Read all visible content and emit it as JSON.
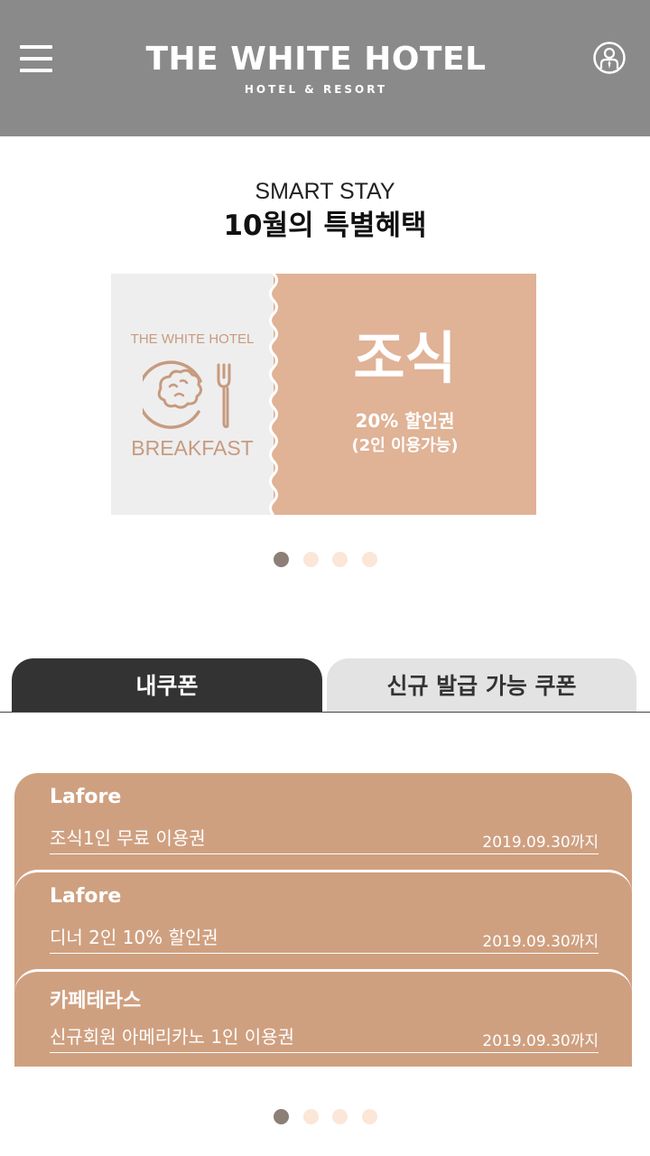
{
  "header": {
    "brand_title": "THE WHITE HOTEL",
    "brand_subtitle": "HOTEL & RESORT",
    "menu_icon": "hamburger-menu-icon",
    "profile_icon": "user-profile-icon",
    "background_color": "#8a8a8a"
  },
  "promo": {
    "kicker": "SMART STAY",
    "title": "10월의 특별혜택",
    "banner": {
      "hotel_label": "THE WHITE HOTEL",
      "category_label": "BREAKFAST",
      "main_label": "조식",
      "discount_label": "20% 할인권",
      "note_label": "(2인 이용가능)",
      "icon": "breakfast-plate-fork-icon",
      "accent_color": "#e0b296"
    },
    "carousel": {
      "total": 4,
      "active_index": 0
    }
  },
  "tabs": [
    {
      "label": "내쿠폰",
      "active": true
    },
    {
      "label": "신규 발급 가능 쿠폰",
      "active": false
    }
  ],
  "coupons": [
    {
      "name": "Lafore",
      "description": "조식1인 무료 이용권",
      "expiry": "2019.09.30까지"
    },
    {
      "name": "Lafore",
      "description": "디너 2인 10% 할인권",
      "expiry": "2019.09.30까지"
    },
    {
      "name": "카페테라스",
      "description": "신규회원 아메리카노 1인 이용권",
      "expiry": "2019.09.30까지"
    }
  ],
  "coupon_carousel": {
    "total": 4,
    "active_index": 0
  },
  "colors": {
    "coupon": "#cfa080",
    "tab_active": "#333333",
    "tab_inactive": "#e3e3e3",
    "dot_active": "#8b7f77",
    "dot_inactive": "#fbe6d8"
  }
}
